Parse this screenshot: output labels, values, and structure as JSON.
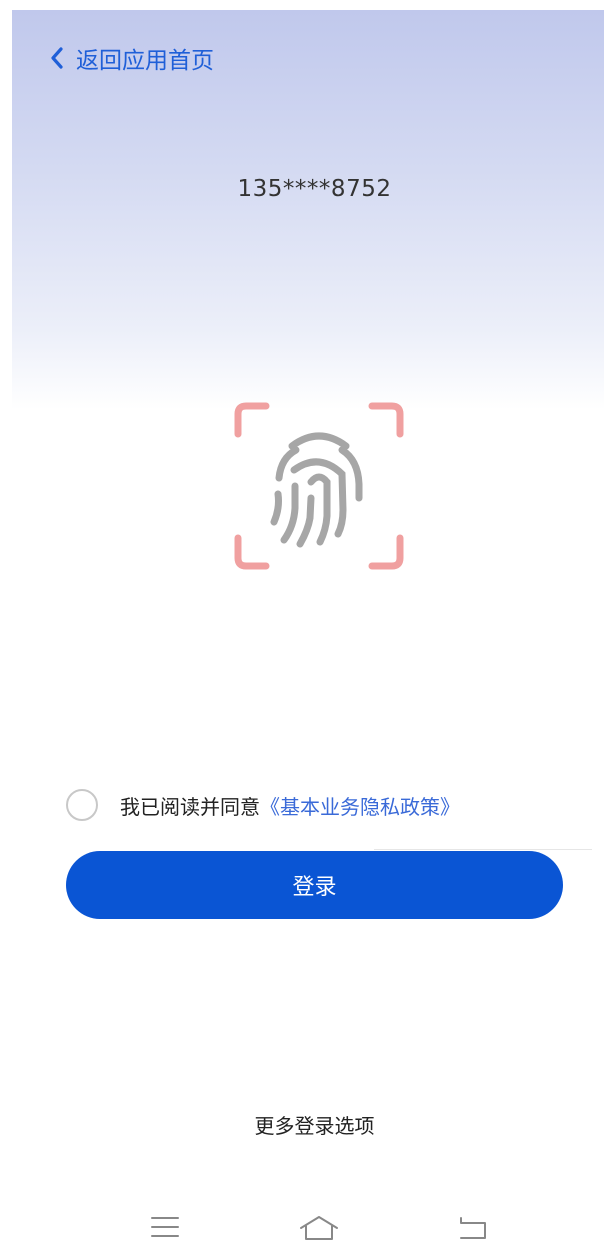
{
  "header": {
    "back_label": "返回应用首页",
    "back_icon": "chevron-left-icon"
  },
  "account": {
    "phone_masked": "135****8752"
  },
  "fingerprint": {
    "icon": "fingerprint-icon",
    "corner_color": "#f0a0a0",
    "print_color": "#a6a6a6"
  },
  "agreement": {
    "checked": false,
    "text": "我已阅读并同意",
    "link_label": "《基本业务隐私政策》"
  },
  "login": {
    "button_label": "登录",
    "button_color": "#0a55d4"
  },
  "more_options_label": "更多登录选项",
  "navigation": {
    "menu_icon": "menu-icon",
    "home_icon": "home-icon",
    "back_icon": "back-icon"
  },
  "colors": {
    "accent": "#1f5fd8",
    "link": "#3a6ad8"
  }
}
